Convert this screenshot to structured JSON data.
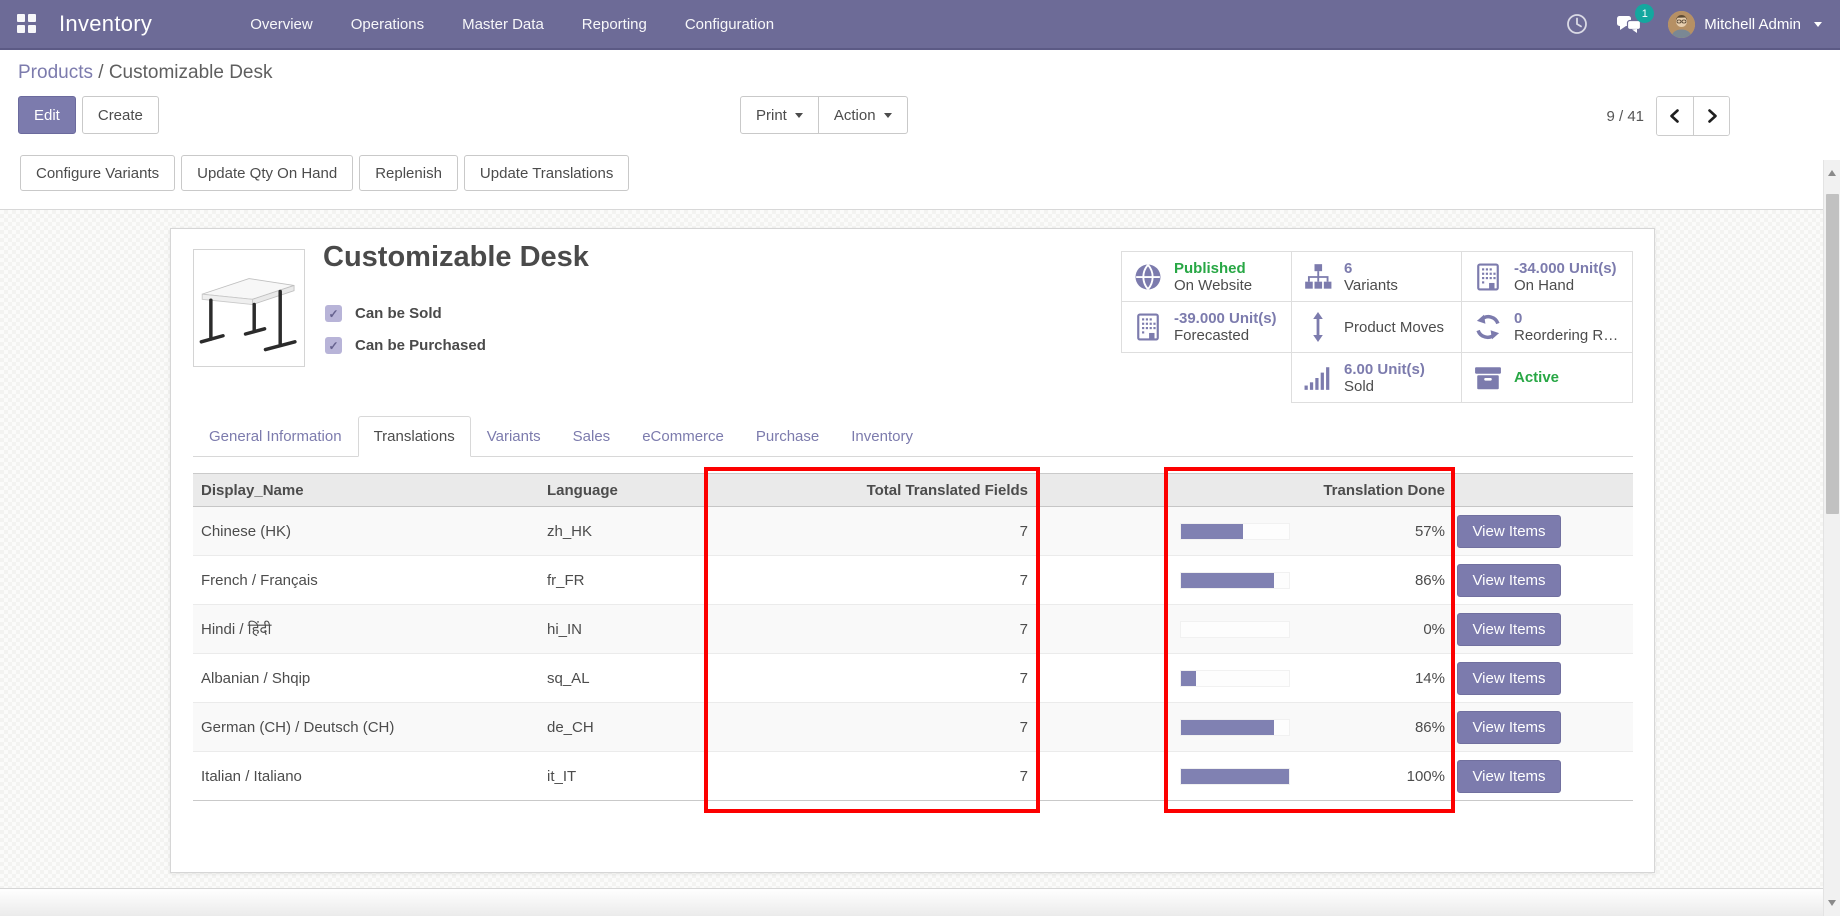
{
  "colors": {
    "navbar_purple": "#6d6b97",
    "accent_purple": "#7c7bad",
    "progress_purple": "#8081b2",
    "highlight_red": "#fc0000",
    "success_green": "#28a745",
    "badge_teal": "#14a79f"
  },
  "navbar": {
    "app_name": "Inventory",
    "menus": [
      "Overview",
      "Operations",
      "Master Data",
      "Reporting",
      "Configuration"
    ],
    "message_count": "1",
    "user_name": "Mitchell Admin"
  },
  "breadcrumb": {
    "parent": "Products",
    "separator": "/",
    "current": "Customizable Desk"
  },
  "control_panel": {
    "edit_label": "Edit",
    "create_label": "Create",
    "print_label": "Print",
    "action_label": "Action",
    "pager_value": "9 / 41"
  },
  "toolbar": {
    "buttons": [
      "Configure Variants",
      "Update Qty On Hand",
      "Replenish",
      "Update Translations"
    ]
  },
  "product": {
    "title": "Customizable Desk",
    "checkbox_sold": "Can be Sold",
    "checkbox_purchased": "Can be Purchased",
    "check_glyph": "✓"
  },
  "stat_buttons": [
    {
      "value": "Published",
      "label": "On Website"
    },
    {
      "value": "6",
      "label": "Variants"
    },
    {
      "value": "-34.000 Unit(s)",
      "label": "On Hand"
    },
    {
      "value": "-39.000 Unit(s)",
      "label": "Forecasted"
    },
    {
      "value": "Product Moves",
      "label": "Product Moves"
    },
    {
      "value": "0",
      "label": "Reordering R…"
    },
    {
      "value": "6.00 Unit(s)",
      "label": "Sold"
    },
    {
      "value": "Active",
      "label": "Active"
    }
  ],
  "tabs": [
    {
      "label": "General Information"
    },
    {
      "label": "Translations"
    },
    {
      "label": "Variants"
    },
    {
      "label": "Sales"
    },
    {
      "label": "eCommerce"
    },
    {
      "label": "Purchase"
    },
    {
      "label": "Inventory"
    }
  ],
  "table": {
    "headers": {
      "display_name": "Display_Name",
      "language": "Language",
      "total": "Total Translated Fields",
      "done": "Translation Done"
    },
    "rows": [
      {
        "name": "Chinese (HK)",
        "lang": "zh_HK",
        "fields": "7",
        "done": "57%",
        "bar_style": "width:57%",
        "action": "View Items"
      },
      {
        "name": "French / Français",
        "lang": "fr_FR",
        "fields": "7",
        "done": "86%",
        "bar_style": "width:86%",
        "action": "View Items"
      },
      {
        "name": "Hindi / हिंदी",
        "lang": "hi_IN",
        "fields": "7",
        "done": "0%",
        "bar_style": "width:0%",
        "action": "View Items"
      },
      {
        "name": "Albanian / Shqip",
        "lang": "sq_AL",
        "fields": "7",
        "done": "14%",
        "bar_style": "width:14%",
        "action": "View Items"
      },
      {
        "name": "German (CH) / Deutsch (CH)",
        "lang": "de_CH",
        "fields": "7",
        "done": "86%",
        "bar_style": "width:86%",
        "action": "View Items"
      },
      {
        "name": "Italian / Italiano",
        "lang": "it_IT",
        "fields": "7",
        "done": "100%",
        "bar_style": "width:100%",
        "action": "View Items"
      }
    ]
  }
}
